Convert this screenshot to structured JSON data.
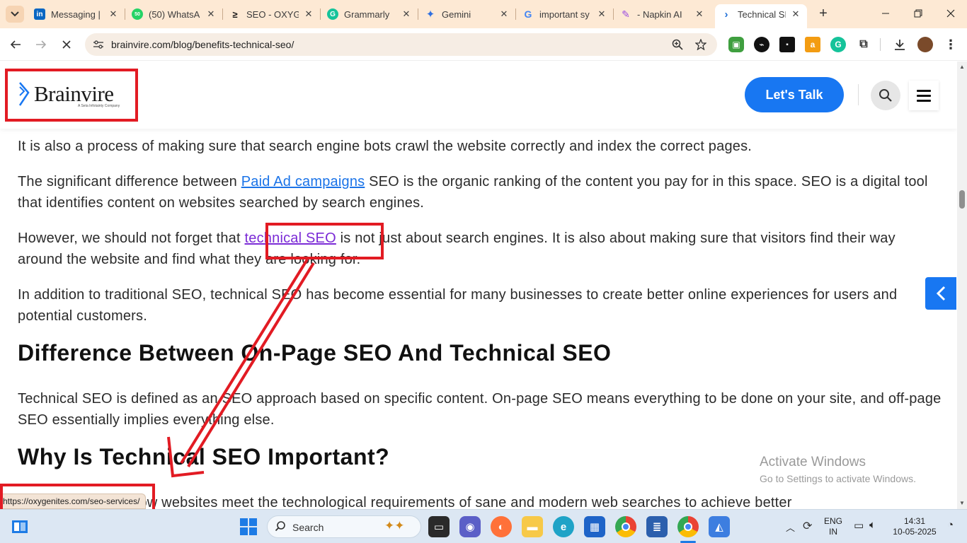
{
  "browser": {
    "tabs": [
      {
        "title": "Messaging |",
        "icon": "linkedin-icon",
        "color": "#0a66c2",
        "glyph": "in"
      },
      {
        "title": "(50) WhatsA",
        "icon": "whatsapp-icon",
        "color": "#25d366",
        "glyph": "50"
      },
      {
        "title": "SEO - OXYGE",
        "icon": "oxygenites-icon",
        "color": "#ffffff",
        "glyph": "≥"
      },
      {
        "title": "Grammarly",
        "icon": "grammarly-icon",
        "color": "#15c39a",
        "glyph": "G"
      },
      {
        "title": "Gemini",
        "icon": "gemini-icon",
        "color": "#ffffff",
        "glyph": "✦"
      },
      {
        "title": "important sy",
        "icon": "google-icon",
        "color": "#ffffff",
        "glyph": "G"
      },
      {
        "title": "- Napkin AI",
        "icon": "napkin-icon",
        "color": "#ffffff",
        "glyph": "✎"
      },
      {
        "title": "Technical SE",
        "icon": "brainvire-icon",
        "color": "#ffffff",
        "glyph": "›"
      }
    ],
    "close_glyph": "✕",
    "new_tab_glyph": "+",
    "url": "brainvire.com/blog/benefits-technical-seo/"
  },
  "site": {
    "logo_text": "Brainvire",
    "logo_subtext": "A Seta Infotainty Company",
    "cta_label": "Let's Talk",
    "colors": {
      "brand_blue": "#1877f2",
      "annotation_red": "#e21b23"
    }
  },
  "article": {
    "p1": "It is also a process of making sure that search engine bots crawl the website correctly and index the correct pages.",
    "p2_before": "The significant difference between ",
    "p2_link": "Paid Ad campaigns",
    "p2_after": " SEO is the organic ranking of the content you pay for in this space. SEO is a digital tool that identifies content on websites searched by search engines.",
    "p3_before": "However, we should not forget that ",
    "p3_link": "technical SEO",
    "p3_after": " is not just about search engines. It is also about making sure that visitors find their way around the website and find what they are looking for.",
    "p4": "In addition to traditional SEO, technical SEO has become essential for many businesses to create better online experiences for users and potential customers.",
    "h2_a": "Difference Between On-Page SEO And Technical SEO",
    "p5": "Technical SEO is defined as an SEO approach based on specific content. On-page SEO means everything to be done on your site, and off-page SEO essentially implies everything else.",
    "h2_b": "Why Is Technical SEO Important?",
    "p6": "Technical SEO is how websites meet the technological requirements of sane and modern web searches to achieve better"
  },
  "status_bar_url": "https://oxygenites.com/seo-services/",
  "watermark": {
    "line1": "Activate Windows",
    "line2": "Go to Settings to activate Windows."
  },
  "taskbar": {
    "search_label": "Search",
    "language": "ENG",
    "region": "IN",
    "time": "14:31",
    "date": "10-05-2025"
  }
}
